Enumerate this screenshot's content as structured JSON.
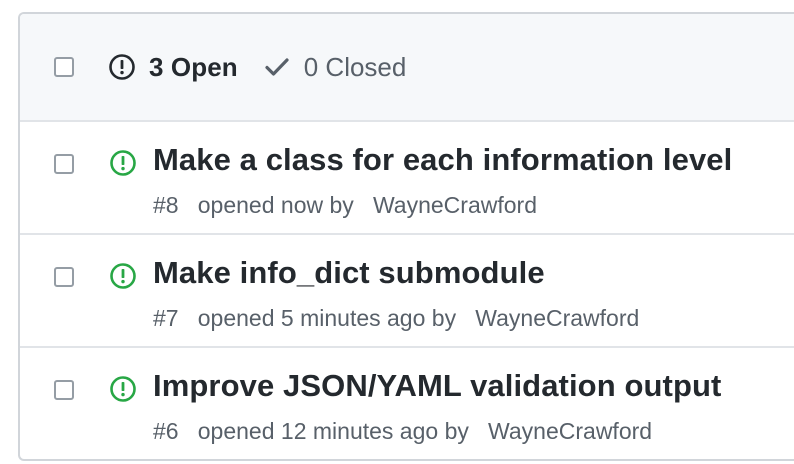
{
  "header": {
    "open_count_label": "3 Open",
    "closed_count_label": "0 Closed",
    "open_icon": "issue-opened-icon",
    "closed_icon": "check-icon"
  },
  "colors": {
    "open_green": "#28a745",
    "text_dark": "#24292e",
    "text_muted": "#586069",
    "header_bg": "#f6f8fa",
    "border": "#d1d5da"
  },
  "issues": [
    {
      "title": "Make a class for each information level",
      "number": "#8",
      "opened_text": "opened now by",
      "author": "WayneCrawford",
      "icon": "issue-opened-icon"
    },
    {
      "title": "Make info_dict submodule",
      "number": "#7",
      "opened_text": "opened 5 minutes ago by",
      "author": "WayneCrawford",
      "icon": "issue-opened-icon"
    },
    {
      "title": "Improve JSON/YAML validation output",
      "number": "#6",
      "opened_text": "opened 12 minutes ago by",
      "author": "WayneCrawford",
      "icon": "issue-opened-icon"
    }
  ]
}
